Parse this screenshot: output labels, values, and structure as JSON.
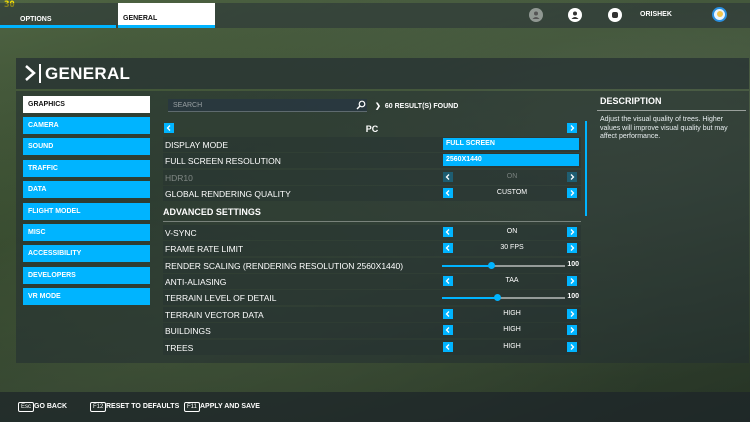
{
  "overlay": {
    "fps_text": "30"
  },
  "topbar": {
    "options_tab": "OPTIONS",
    "general_tab": "GENERAL",
    "username": "ORISHEK"
  },
  "header": {
    "title": "GENERAL"
  },
  "sidebar": {
    "items": [
      {
        "label": "GRAPHICS",
        "active": true
      },
      {
        "label": "CAMERA"
      },
      {
        "label": "SOUND"
      },
      {
        "label": "TRAFFIC"
      },
      {
        "label": "DATA"
      },
      {
        "label": "FLIGHT MODEL"
      },
      {
        "label": "MISC"
      },
      {
        "label": "ACCESSIBILITY"
      },
      {
        "label": "DEVELOPERS"
      },
      {
        "label": "VR MODE"
      }
    ]
  },
  "search": {
    "placeholder": "SEARCH",
    "results": "60 RESULT(S) FOUND"
  },
  "settings": {
    "platform": "PC",
    "display_mode": {
      "label": "DISPLAY MODE",
      "value": "FULL SCREEN"
    },
    "resolution": {
      "label": "FULL SCREEN RESOLUTION",
      "value": "2560X1440"
    },
    "hdr10": {
      "label": "HDR10",
      "value": "ON"
    },
    "global_quality": {
      "label": "GLOBAL RENDERING QUALITY",
      "value": "CUSTOM"
    },
    "advanced_title": "ADVANCED SETTINGS",
    "vsync": {
      "label": "V-SYNC",
      "value": "ON"
    },
    "frame_rate": {
      "label": "FRAME RATE LIMIT",
      "value": "30 FPS"
    },
    "render_scaling": {
      "label": "RENDER SCALING (RENDERING RESOLUTION 2560X1440)",
      "value": "100",
      "level": 0.4
    },
    "anti_aliasing": {
      "label": "ANTI-ALIASING",
      "value": "TAA"
    },
    "terrain_lod": {
      "label": "TERRAIN LEVEL OF DETAIL",
      "value": "100",
      "level": 0.45
    },
    "terrain_vector": {
      "label": "TERRAIN VECTOR DATA",
      "value": "HIGH"
    },
    "buildings": {
      "label": "BUILDINGS",
      "value": "HIGH"
    },
    "trees": {
      "label": "TREES",
      "value": "HIGH"
    }
  },
  "description": {
    "title": "DESCRIPTION",
    "text": "Adjust the visual quality of trees. Higher values will improve visual quality but may affect performance."
  },
  "footer": {
    "back_key": "Esc",
    "back_label": "GO BACK",
    "reset_key": "F12",
    "reset_label": "RESET TO DEFAULTS",
    "apply_key": "F11",
    "apply_label": "APPLY AND SAVE"
  },
  "colors": {
    "accent": "#00b4ff",
    "active_tab": "#ffffff"
  }
}
